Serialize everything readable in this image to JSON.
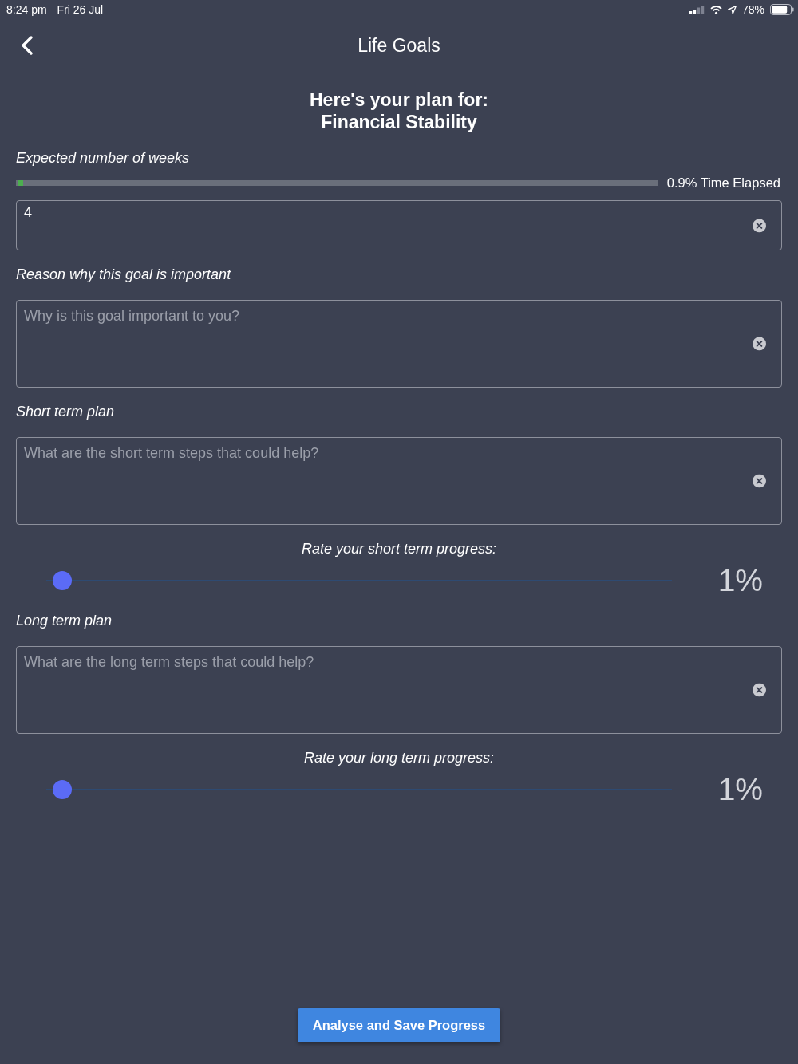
{
  "status_bar": {
    "time": "8:24 pm",
    "date": "Fri 26 Jul",
    "battery": "78%"
  },
  "nav_bar": {
    "title": "Life Goals"
  },
  "heading": {
    "intro": "Here's your plan for:",
    "goal": "Financial Stability"
  },
  "form": [
    {
      "kind": "input",
      "label": "Expected number of weeks",
      "progress": {
        "level": 0.009,
        "reading": "0.9% Time Elapsed"
      },
      "value": "4"
    },
    {
      "kind": "textarea",
      "label": "Reason why this goal is important",
      "placeholder": "Why is this goal important to you?"
    },
    {
      "kind": "textarea",
      "label": "Short term plan",
      "placeholder": "What are the short term steps that could help?"
    },
    {
      "kind": "rating",
      "label": "Rate your short term progress:",
      "level": 0.01,
      "reading": "1%"
    },
    {
      "kind": "textarea",
      "label": "Long term plan",
      "placeholder": "What are the long term steps that could help?"
    },
    {
      "kind": "rating",
      "label": "Rate your long term progress:",
      "level": 0.01,
      "reading": "1%"
    }
  ],
  "button": {
    "label": "Analyse and Save Progress"
  }
}
